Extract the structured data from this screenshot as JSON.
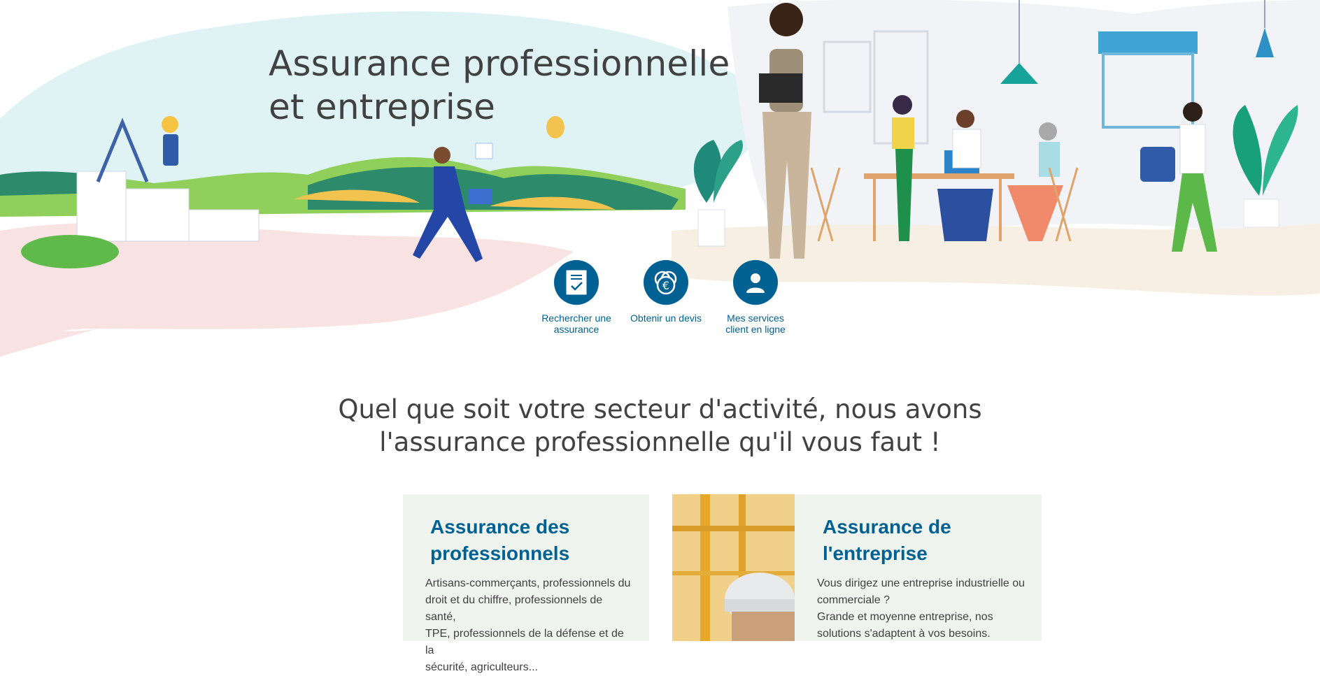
{
  "hero": {
    "title_line1": "Assurance professionnelle",
    "title_line2": "et entreprise"
  },
  "quick_links": [
    {
      "icon": "document-check-icon",
      "label_line1": "Rechercher une",
      "label_line2": "assurance"
    },
    {
      "icon": "euro-coin-icon",
      "label_line1": "Obtenir un devis",
      "label_line2": ""
    },
    {
      "icon": "user-icon",
      "label_line1": "Mes services",
      "label_line2": "client en ligne"
    }
  ],
  "section": {
    "title_line1": "Quel que soit votre secteur d'activité, nous avons",
    "title_line2": "l'assurance professionnelle qu'il vous faut !"
  },
  "cards": [
    {
      "title_line1": "Assurance des",
      "title_line2": "professionnels",
      "text_lines": [
        "Artisans-commerçants, professionnels du",
        "droit et du chiffre, professionnels de santé,",
        "TPE, professionnels de la défense et de la",
        "sécurité, agriculteurs..."
      ]
    },
    {
      "title_line1": "Assurance de",
      "title_line2": "l'entreprise",
      "text_lines": [
        "Vous dirigez une entreprise industrielle ou",
        "commerciale ?",
        "Grande et moyenne entreprise, nos",
        "solutions s'adaptent à vos besoins."
      ]
    }
  ],
  "colors": {
    "brand_blue": "#006192",
    "text_grey": "#414141",
    "card_bg": "#eff4ef",
    "hero_sky": "#dff3f4",
    "hero_pink": "#f9e3e2"
  }
}
